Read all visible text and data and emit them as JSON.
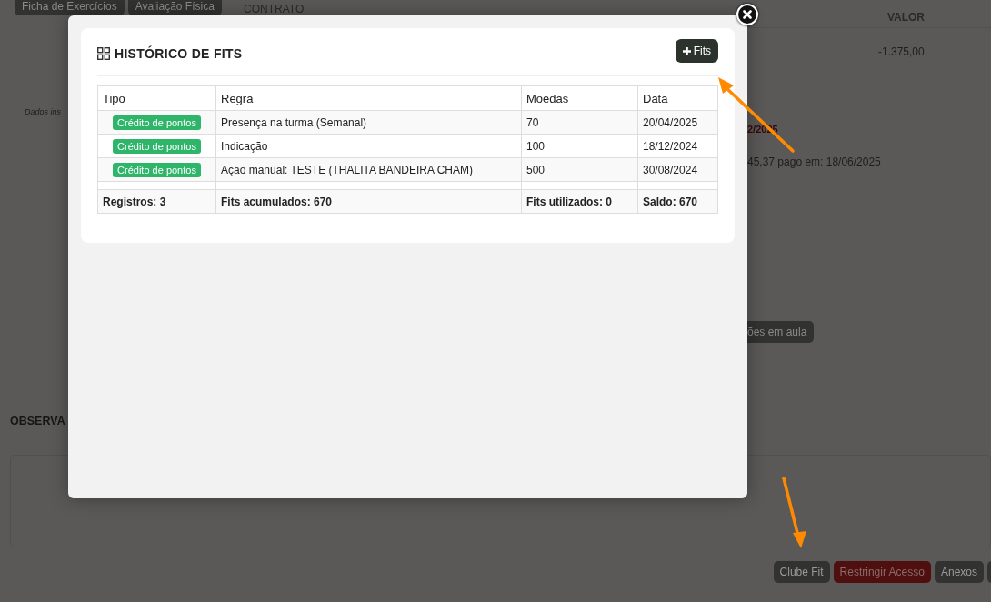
{
  "background": {
    "top_buttons": [
      "Ficha de Exercícios",
      "Avaliação Física"
    ],
    "columns": [
      "CONTRATO",
      "VALOR"
    ],
    "value": "-1.375,00",
    "note": "Dados ins",
    "date_fragment": "2/2025",
    "payment": "45,37 pago em: 18/06/2025",
    "class_button": "ões em aula",
    "observations_title": "OBSERVA",
    "actions": [
      {
        "label": "Clube Fit",
        "kind": "dark"
      },
      {
        "label": "Restringir Acesso",
        "kind": "danger"
      },
      {
        "label": "Anexos",
        "kind": "dark"
      }
    ]
  },
  "modal": {
    "title": "HISTÓRICO DE FITS",
    "add_button": "Fits",
    "table": {
      "columns": [
        "Tipo",
        "Regra",
        "Moedas",
        "Data"
      ],
      "rows": [
        {
          "tipo": "Crédito de pontos",
          "regra": "Presença na turma (Semanal)",
          "moedas": "70",
          "data": "20/04/2025"
        },
        {
          "tipo": "Crédito de pontos",
          "regra": "Indicação",
          "moedas": "100",
          "data": "18/12/2024"
        },
        {
          "tipo": "Crédito de pontos",
          "regra": "Ação manual: TESTE (THALITA BANDEIRA CHAM)",
          "moedas": "500",
          "data": "30/08/2024"
        }
      ],
      "footer": [
        "Registros: 3",
        "Fits acumulados: 670",
        "Fits utilizados: 0",
        "Saldo: 670"
      ]
    }
  }
}
